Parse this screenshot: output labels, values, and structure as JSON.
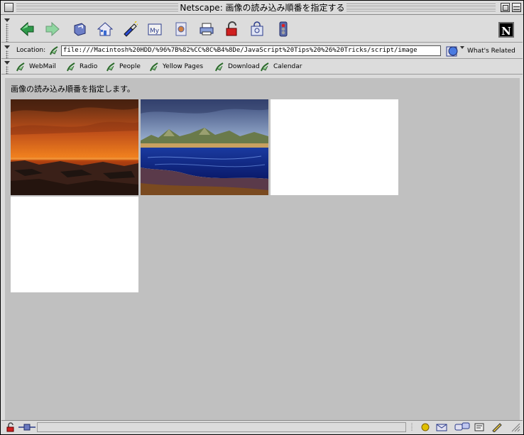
{
  "window": {
    "title": "Netscape: 画像の読み込み順番を指定する"
  },
  "nav_toolbar": {
    "buttons": [
      {
        "name": "back",
        "icon": "back-arrow-icon"
      },
      {
        "name": "forward",
        "icon": "forward-arrow-icon"
      },
      {
        "name": "reload",
        "icon": "reload-icon"
      },
      {
        "name": "home",
        "icon": "home-icon"
      },
      {
        "name": "search",
        "icon": "search-flashlight-icon"
      },
      {
        "name": "my-netscape",
        "icon": "my-netscape-icon"
      },
      {
        "name": "images",
        "icon": "images-icon"
      },
      {
        "name": "print",
        "icon": "print-icon"
      },
      {
        "name": "security",
        "icon": "security-lock-icon"
      },
      {
        "name": "shop",
        "icon": "shop-icon"
      },
      {
        "name": "stop",
        "icon": "stop-traffic-light-icon"
      }
    ]
  },
  "location": {
    "label": "Location:",
    "url": "file:///Macintosh%20HDD/%96%7B%82%CC%8C%B4%8De/JavaScript%20Tips%20%26%20Tricks/script/image",
    "whats_related": "What's Related"
  },
  "personal_toolbar": {
    "items": [
      "WebMail",
      "Radio",
      "People",
      "Yellow Pages",
      "Download",
      "Calendar"
    ]
  },
  "page": {
    "heading": "画像の読み込み順番を指定します。",
    "images": [
      {
        "kind": "sunset-landscape",
        "loaded": true
      },
      {
        "kind": "coastal-landscape",
        "loaded": true
      },
      {
        "kind": "blank",
        "loaded": false
      },
      {
        "kind": "blank",
        "loaded": false
      }
    ]
  },
  "colors": {
    "chrome": "#dcdcdc",
    "page_background": "#c0c0c0"
  }
}
